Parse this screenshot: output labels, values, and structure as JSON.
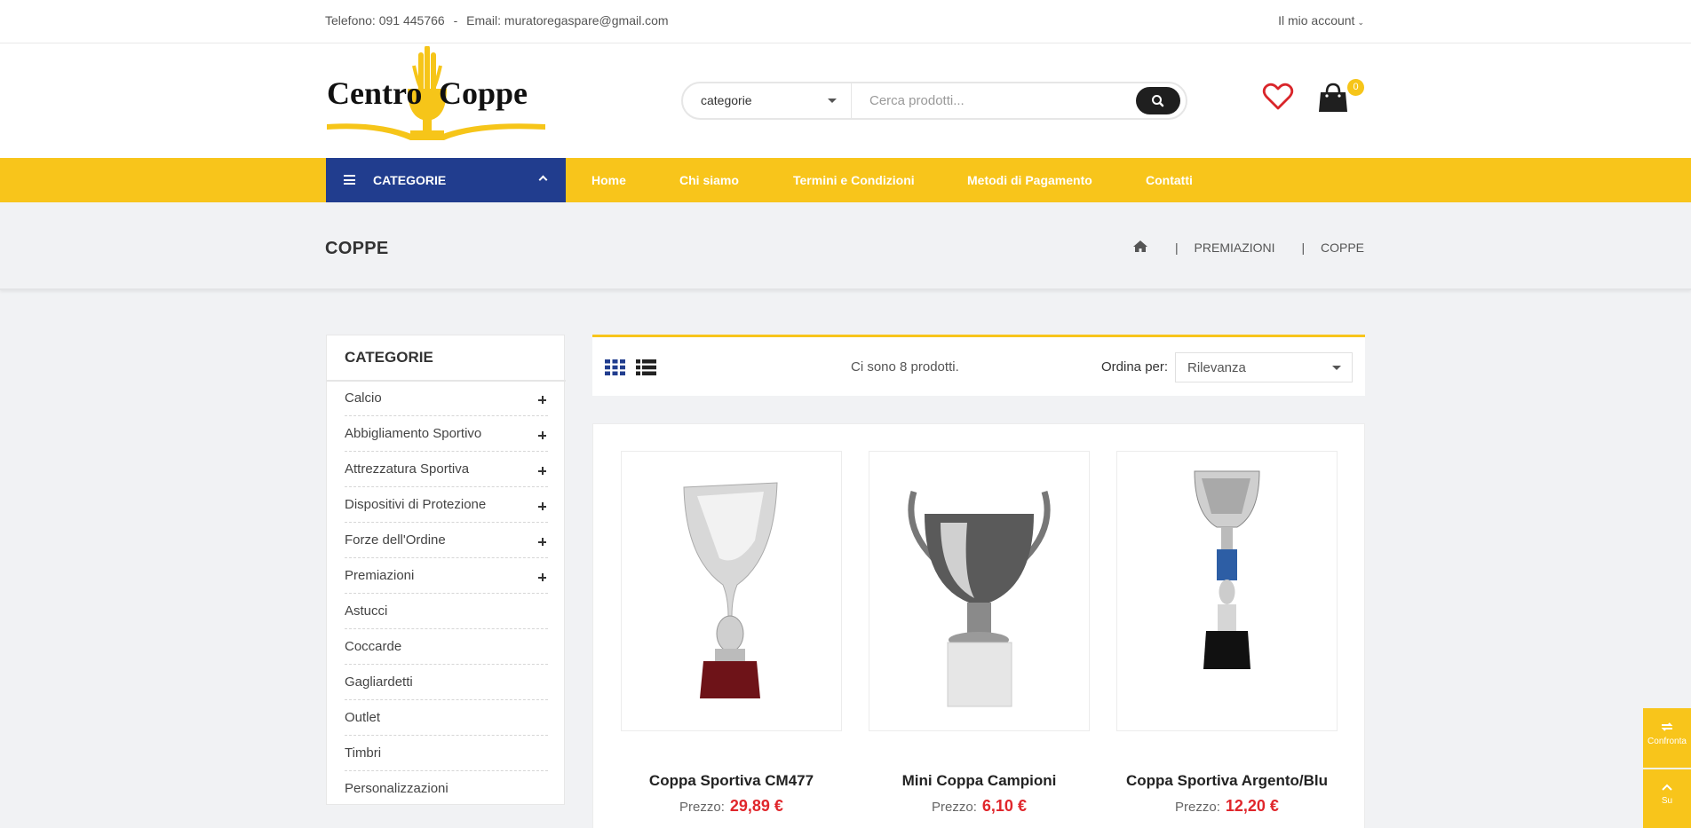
{
  "topbar": {
    "phone": "Telefono: 091 445766",
    "separator": "-",
    "email": "Email: muratoregaspare@gmail.com",
    "account": "Il mio account"
  },
  "header": {
    "logo_text_left": "Centro",
    "logo_text_right": "Coppe",
    "search_category": "categorie",
    "search_placeholder": "Cerca prodotti...",
    "cart_count": "0"
  },
  "nav": {
    "categories_label": "CATEGORIE",
    "items": [
      "Home",
      "Chi siamo",
      "Termini e Condizioni",
      "Metodi di Pagamento",
      "Contatti"
    ]
  },
  "page": {
    "title": "COPPE",
    "breadcrumb": [
      "PREMIAZIONI",
      "COPPE"
    ],
    "breadcrumb_sep": "|"
  },
  "sidebar": {
    "title": "CATEGORIE",
    "items": [
      {
        "label": "Calcio",
        "expandable": true
      },
      {
        "label": "Abbigliamento Sportivo",
        "expandable": true
      },
      {
        "label": "Attrezzatura Sportiva",
        "expandable": true
      },
      {
        "label": "Dispositivi di Protezione",
        "expandable": true
      },
      {
        "label": "Forze dell'Ordine",
        "expandable": true
      },
      {
        "label": "Premiazioni",
        "expandable": true
      },
      {
        "label": "Astucci",
        "expandable": false
      },
      {
        "label": "Coccarde",
        "expandable": false
      },
      {
        "label": "Gagliardetti",
        "expandable": false
      },
      {
        "label": "Outlet",
        "expandable": false
      },
      {
        "label": "Timbri",
        "expandable": false
      },
      {
        "label": "Personalizzazioni",
        "expandable": false
      }
    ]
  },
  "toolbar": {
    "count_text": "Ci sono 8 prodotti.",
    "sort_label": "Ordina per:",
    "sort_value": "Rilevanza"
  },
  "products": [
    {
      "name": "Coppa Sportiva CM477",
      "price_label": "Prezzo:",
      "price": "29,89 €"
    },
    {
      "name": "Mini Coppa Campioni",
      "price_label": "Prezzo:",
      "price": "6,10 €"
    },
    {
      "name": "Coppa Sportiva Argento/Blu",
      "price_label": "Prezzo:",
      "price": "12,20 €"
    }
  ],
  "floating": {
    "compare": "Confronta",
    "up": "Su"
  },
  "colors": {
    "accent_yellow": "#f8c51b",
    "nav_blue": "#213d8e",
    "price_red": "#e0262b"
  }
}
